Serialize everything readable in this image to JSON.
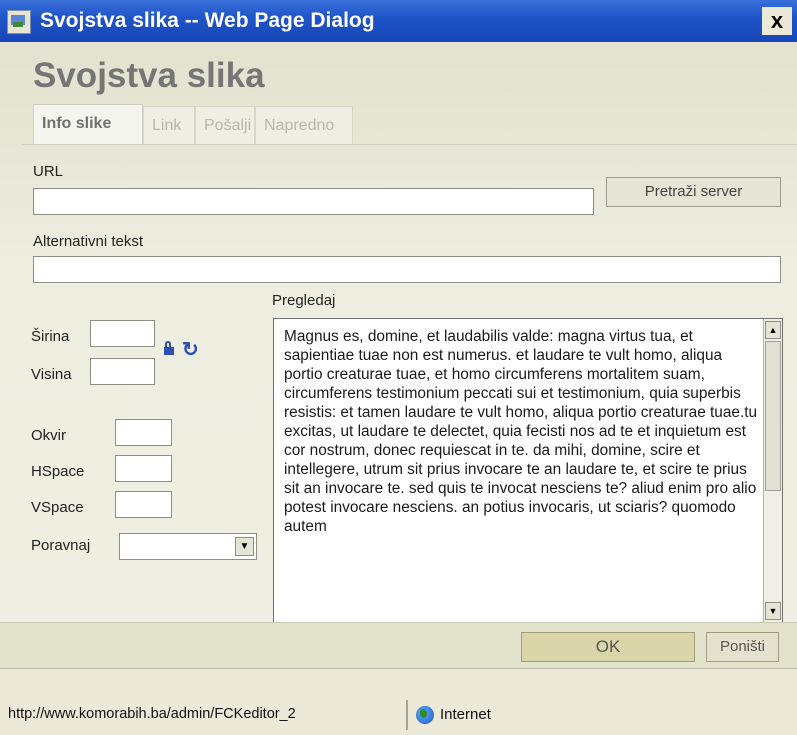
{
  "window": {
    "title": "Svojstva slika -- Web Page Dialog",
    "close_label": "x"
  },
  "dialog": {
    "title": "Svojstva slika",
    "tabs": [
      {
        "label": "Info slike",
        "active": true
      },
      {
        "label": "Link",
        "active": false
      },
      {
        "label": "Pošalji",
        "active": false
      },
      {
        "label": "Napredno",
        "active": false
      }
    ],
    "url": {
      "label": "URL",
      "value": ""
    },
    "browse_button": "Pretraži server",
    "alt_text": {
      "label": "Alternativni tekst",
      "value": ""
    },
    "width_label": "Širina",
    "height_label": "Visina",
    "border_label": "Okvir",
    "hspace_label": "HSpace",
    "vspace_label": "VSpace",
    "align": {
      "label": "Poravnaj",
      "value": ""
    },
    "preview": {
      "label": "Pregledaj",
      "text": "Magnus es, domine, et laudabilis valde: magna virtus tua, et sapientiae tuae non est numerus. et laudare te vult homo, aliqua portio creaturae tuae, et homo circumferens mortalitem suam, circumferens testimonium peccati sui et testimonium, quia superbis resistis: et tamen laudare te vult homo, aliqua portio creaturae tuae.tu excitas, ut laudare te delectet, quia fecisti nos ad te et inquietum est cor nostrum, donec requiescat in te. da mihi, domine, scire et intellegere, utrum sit prius invocare te an laudare te, et scire te prius sit an invocare te. sed quis te invocat nesciens te? aliud enim pro alio potest invocare nesciens. an potius invocaris, ut sciaris? quomodo autem"
    },
    "ok_button": "OK",
    "cancel_button": "Poništi"
  },
  "status_bar": {
    "url": "http://www.komorabih.ba/admin/FCKeditor_2",
    "zone": "Internet"
  },
  "icons": {
    "lock": "lock-icon",
    "reset": "reset-size-icon",
    "globe": "globe-icon"
  }
}
